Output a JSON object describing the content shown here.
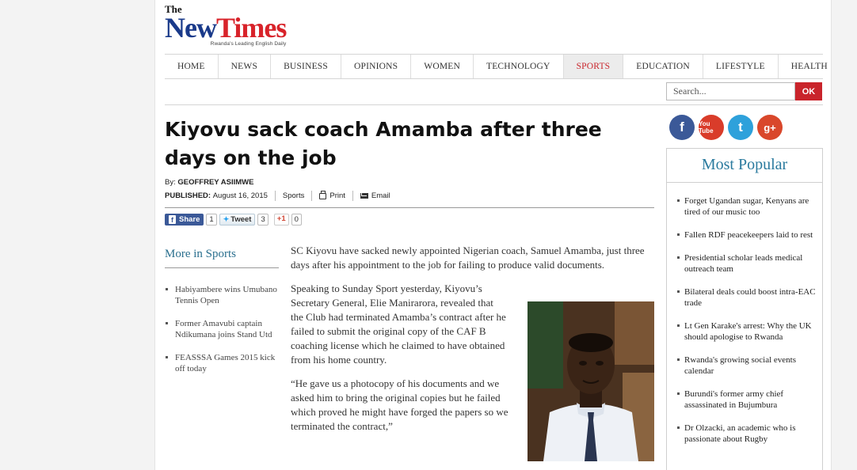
{
  "logo": {
    "the": "The",
    "new": "New",
    "times": "Times",
    "tagline": "Rwanda's Leading English Daily"
  },
  "nav": [
    {
      "label": "HOME"
    },
    {
      "label": "NEWS"
    },
    {
      "label": "BUSINESS"
    },
    {
      "label": "OPINIONS"
    },
    {
      "label": "WOMEN"
    },
    {
      "label": "TECHNOLOGY"
    },
    {
      "label": "SPORTS",
      "active": true
    },
    {
      "label": "EDUCATION"
    },
    {
      "label": "LIFESTYLE"
    },
    {
      "label": "HEALTH"
    }
  ],
  "search": {
    "placeholder": "Search...",
    "button": "OK"
  },
  "article": {
    "headline": "Kiyovu sack coach Amamba after three days on the job",
    "by_label": "By:",
    "author": "GEOFFREY ASIIMWE",
    "published_label": "PUBLISHED:",
    "date": "August 16, 2015",
    "section": "Sports",
    "print": "Print",
    "email": "Email",
    "paragraphs": [
      "SC Kiyovu have sacked newly appointed Nigerian coach, Samuel Amamba, just three days after his appointment to the job for failing to produce valid documents.",
      "Speaking to Sunday Sport yesterday, Kiyovu’s Secretary General, Elie Manirarora, revealed that the Club had terminated Amamba’s contract after he failed to submit the original copy of the CAF B coaching license which he claimed to have obtained from his home country.",
      "“He gave us a photocopy of his documents and we asked him to bring the original copies but he failed which proved he might have forged the papers so we terminated the contract,”"
    ]
  },
  "share": {
    "facebook_label": "Share",
    "facebook_count": "1",
    "tweet_label": "Tweet",
    "tweet_count": "3",
    "gplus_label": "+1",
    "gplus_count": "0"
  },
  "more_in_sports": {
    "title": "More in Sports",
    "items": [
      "Habiyambere wins Umubano Tennis Open",
      "Former Amavubi captain Ndikumana joins Stand Utd",
      "FEASSSA Games 2015 kick off today"
    ]
  },
  "social": {
    "fb": "f",
    "yt": "You Tube",
    "tw": "t",
    "gp": "g+"
  },
  "most_popular": {
    "title": "Most Popular",
    "items": [
      "Forget Ugandan sugar, Kenyans are tired of our music too",
      "Fallen RDF peacekeepers laid to rest",
      "Presidential scholar leads medical outreach team",
      "Bilateral deals could boost intra-EAC trade",
      "Lt Gen Karake's arrest: Why the UK should apologise to Rwanda",
      "Rwanda's growing social events calendar",
      "Burundi's former army chief assassinated in Bujumbura",
      "Dr Olzacki, an academic who is passionate about Rugby"
    ]
  },
  "colors": {
    "brand_blue": "#1a3a8a",
    "brand_red": "#d8232a",
    "accent_teal": "#2a7a9e"
  }
}
